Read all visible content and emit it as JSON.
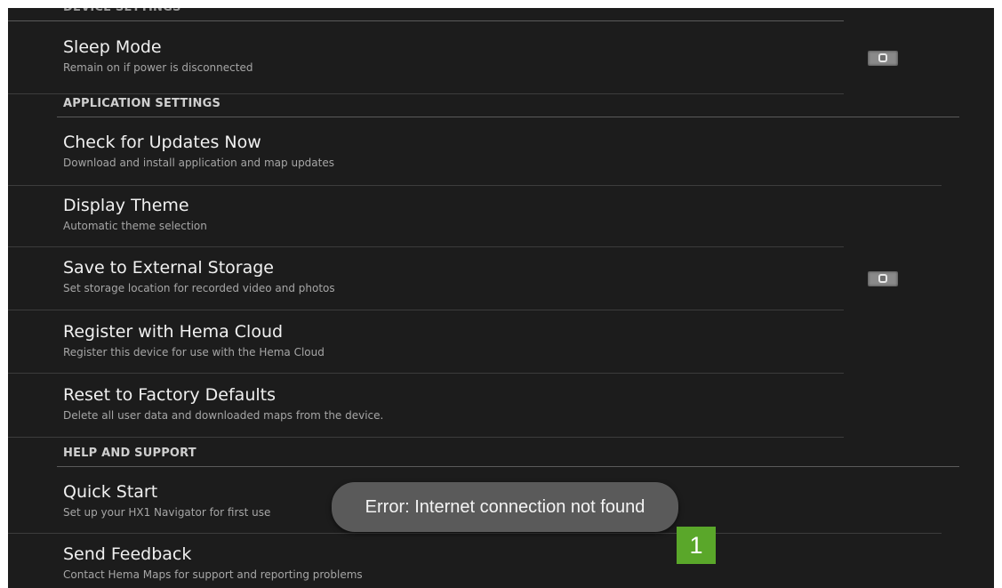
{
  "partial_header": "DEVICE SETTINGS",
  "device": {
    "sleep_mode": {
      "title": "Sleep Mode",
      "subtitle": "Remain on if power is disconnected"
    }
  },
  "application_settings": {
    "header": "APPLICATION SETTINGS",
    "items": [
      {
        "title": "Check for Updates Now",
        "subtitle": "Download and install application and map updates"
      },
      {
        "title": "Display Theme",
        "subtitle": "Automatic theme selection"
      },
      {
        "title": "Save to External Storage",
        "subtitle": "Set storage location for recorded video and photos"
      },
      {
        "title": "Register with Hema Cloud",
        "subtitle": "Register this device for use with the Hema Cloud"
      },
      {
        "title": "Reset to Factory Defaults",
        "subtitle": "Delete all user data and downloaded maps from the device."
      }
    ]
  },
  "help_and_support": {
    "header": "HELP AND SUPPORT",
    "items": [
      {
        "title": "Quick Start",
        "subtitle": "Set up your HX1 Navigator for first use"
      },
      {
        "title": "Send Feedback",
        "subtitle": "Contact Hema Maps for support and reporting problems"
      }
    ]
  },
  "toast": {
    "message": "Error: Internet connection not found"
  },
  "annotation_badge": {
    "label": "1",
    "color": "#5aa72a"
  },
  "colors": {
    "background": "#1c1c1c",
    "title_text": "#f0f0f0",
    "subtitle_text": "#a6a6a6"
  }
}
